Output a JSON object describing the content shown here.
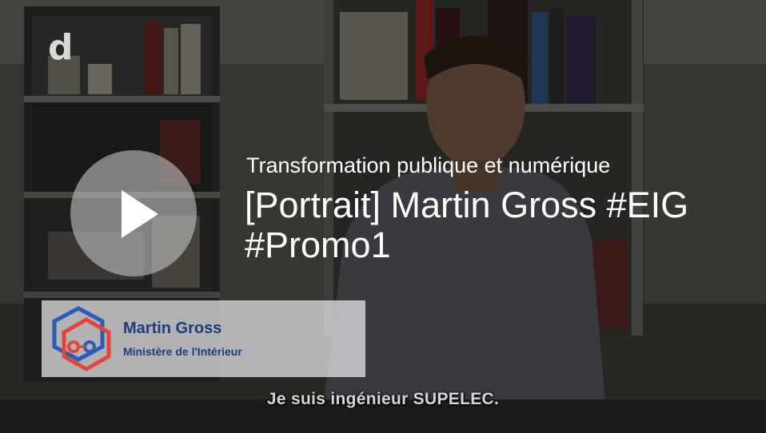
{
  "player": {
    "logo": "d",
    "channel_name": "Transformation publique et numérique",
    "video_title": "[Portrait] Martin Gross #EIG #Promo1",
    "play_label": "Play",
    "lower_third": {
      "name": "Martin Gross",
      "organization": "Ministère de l'Intérieur"
    },
    "subtitle": "Je suis ingénieur SUPELEC."
  },
  "colors": {
    "accent_blue": "#1f3d7a",
    "logo_red": "#e2463a",
    "logo_blue": "#2a5cb8"
  },
  "icons": {
    "play": "play-icon",
    "hexagon_logo": "hexagon-logo-icon"
  }
}
